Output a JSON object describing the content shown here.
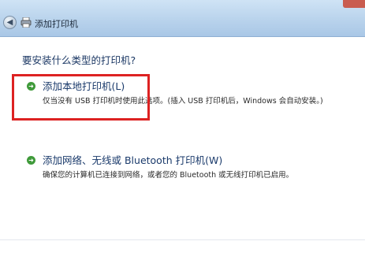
{
  "window": {
    "title": "添加打印机",
    "back_icon": "back-arrow-icon",
    "printer_icon": "printer-icon"
  },
  "question": "要安装什么类型的打印机?",
  "options": [
    {
      "title": "添加本地打印机(L)",
      "description": "仅当没有 USB 打印机时使用此选项。(插入 USB 打印机后，Windows 会自动安装。)",
      "icon": "green-arrow-icon",
      "highlighted": true
    },
    {
      "title": "添加网络、无线或 Bluetooth 打印机(W)",
      "description": "确保您的计算机已连接到网络，或者您的 Bluetooth 或无线打印机已启用。",
      "icon": "green-arrow-icon",
      "highlighted": false
    }
  ],
  "colors": {
    "highlight": "#dd2222",
    "title_text": "#1a3a6b",
    "arrow": "#3f9a3a"
  }
}
